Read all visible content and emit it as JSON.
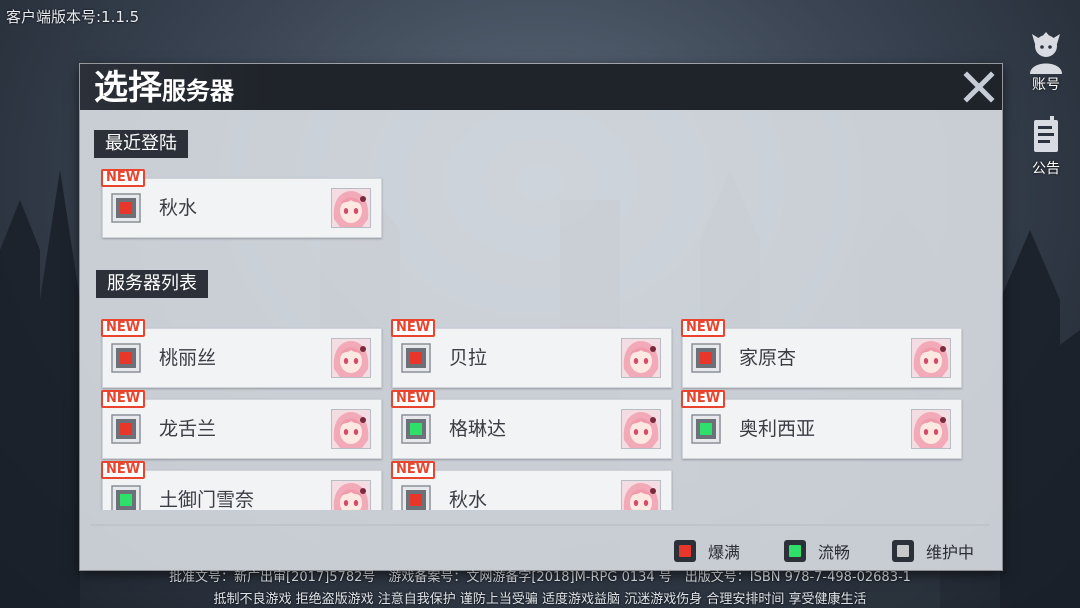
{
  "client_version": "客户端版本号:1.1.5",
  "side_buttons": [
    {
      "label": "账号",
      "icon": "account-icon"
    },
    {
      "label": "公告",
      "icon": "notice-icon"
    }
  ],
  "footer": {
    "line1": "批准文号：新广出审[2017]5782号　游戏备案号：文网游备字[2018]M-RPG 0134 号　出版文号：ISBN 978-7-498-02683-1",
    "line2": "抵制不良游戏  拒绝盗版游戏  注意自我保护  谨防上当受骗  适度游戏益脑  沉迷游戏伤身  合理安排时间  享受健康生活"
  },
  "dialog": {
    "title_big": "选择",
    "title_small": "服务器",
    "close_icon": "close-icon",
    "recent_label": "最近登陆",
    "list_label": "服务器列表",
    "recent": [
      {
        "name": "秋水",
        "status": "full",
        "new": "NEW"
      }
    ],
    "servers": [
      {
        "name": "桃丽丝",
        "status": "full",
        "new": "NEW"
      },
      {
        "name": "贝拉",
        "status": "full",
        "new": "NEW"
      },
      {
        "name": "家原杏",
        "status": "full",
        "new": "NEW"
      },
      {
        "name": "龙舌兰",
        "status": "full",
        "new": "NEW"
      },
      {
        "name": "格琳达",
        "status": "smooth",
        "new": "NEW"
      },
      {
        "name": "奥利西亚",
        "status": "smooth",
        "new": "NEW"
      },
      {
        "name": "土御门雪奈",
        "status": "smooth",
        "new": "NEW"
      },
      {
        "name": "秋水",
        "status": "full",
        "new": "NEW"
      }
    ],
    "legend": [
      {
        "label": "爆满",
        "color": "#e8372a"
      },
      {
        "label": "流畅",
        "color": "#2ee06a"
      },
      {
        "label": "维护中",
        "color": "#c8c8c8"
      }
    ]
  },
  "colors": {
    "full": "#e8372a",
    "smooth": "#2ee06a",
    "maintenance": "#c8c8c8",
    "new_tag": "#e8442e"
  }
}
